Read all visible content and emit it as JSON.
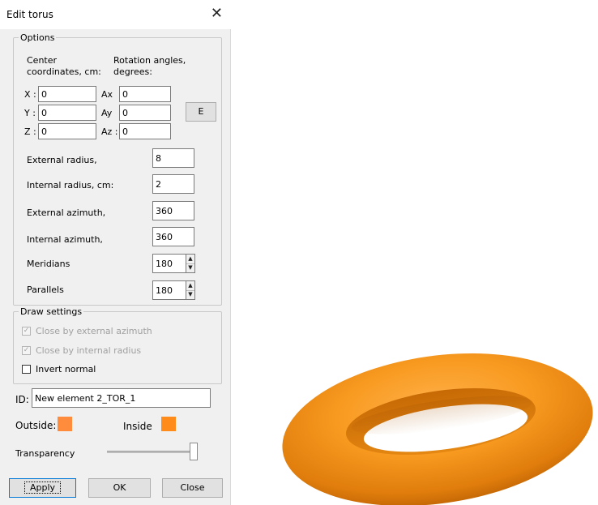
{
  "window": {
    "title": "Edit torus",
    "close_glyph": "✕"
  },
  "options": {
    "legend": "Options",
    "center_label_1": "Center",
    "center_label_2": "coordinates, cm:",
    "rotation_label_1": "Rotation angles,",
    "rotation_label_2": "degrees:",
    "x_label": "X :",
    "x_value": "0",
    "y_label": "Y :",
    "y_value": "0",
    "z_label": "Z :",
    "z_value": "0",
    "ax_label": "Ax",
    "ax_value": "0",
    "ay_label": "Ay",
    "ay_value": "0",
    "az_label": "Az :",
    "az_value": "0",
    "e_button": "E",
    "external_radius_label": "External radius,",
    "external_radius_value": "8",
    "internal_radius_label": "Internal radius, cm:",
    "internal_radius_value": "2",
    "external_azimuth_label": "External azimuth,",
    "external_azimuth_value": "360",
    "internal_azimuth_label": "Internal azimuth,",
    "internal_azimuth_value": "360",
    "meridians_label": "Meridians",
    "meridians_value": "180",
    "parallels_label": "Parallels",
    "parallels_value": "180"
  },
  "draw_settings": {
    "legend": "Draw settings",
    "close_external_label": "Close by external azimuth",
    "close_external_checked": true,
    "close_internal_label": "Close by internal radius",
    "close_internal_checked": true,
    "invert_normal_label": "Invert normal",
    "invert_normal_checked": false
  },
  "id_label": "ID:",
  "id_value": "New element 2_TOR_1",
  "outside_label": "Outside:",
  "inside_label": "Inside",
  "colors": {
    "outside": "#ff8c3c",
    "inside": "#ff8c1a",
    "torus": "#f08c1a"
  },
  "transparency_label": "Transparency",
  "transparency_level": 1.0,
  "buttons": {
    "apply": "Apply",
    "ok": "OK",
    "close": "Close"
  },
  "icons": {
    "spin_up": "up-arrow-icon",
    "spin_down": "down-arrow-icon",
    "check": "check-icon"
  }
}
